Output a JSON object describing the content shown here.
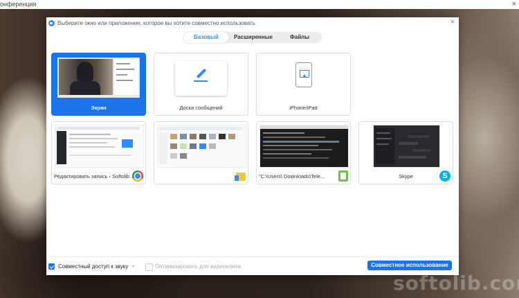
{
  "window": {
    "title": "онференция",
    "close": "×"
  },
  "dialog": {
    "title": "Выберите окно или приложение, которое вы хотите совместно использовать",
    "close": "×"
  },
  "tabs": [
    {
      "label": "Базовый",
      "active": true
    },
    {
      "label": "Расширенные",
      "active": false
    },
    {
      "label": "Файлы",
      "active": false
    }
  ],
  "cards": [
    {
      "label": "Экран",
      "selected": true,
      "icon": "screen-thumbnail"
    },
    {
      "label": "Доска сообщений",
      "selected": false,
      "icon": "pencil-icon"
    },
    {
      "label": "iPhone/iPad",
      "selected": false,
      "icon": "airplay-icon"
    },
    {
      "label": "Редактировать запись ‹ Softolib ...",
      "selected": false,
      "icon": "chrome-icon"
    },
    {
      "label": "",
      "selected": false,
      "icon": "folder-icon"
    },
    {
      "label": "\"C:\\Users\\       Downloads\\Tele...",
      "selected": false,
      "icon": "notepad-icon"
    },
    {
      "label": "Skype",
      "selected": false,
      "icon": "skype-icon"
    }
  ],
  "footer": {
    "share_audio": {
      "label": "Совместный доступ к звуку",
      "checked": true
    },
    "optimize_video": {
      "label": "Оптимизировать для видеоклипа",
      "checked": false,
      "disabled": true
    },
    "share_button": "Совместное использование"
  },
  "watermark": "softolib.com",
  "colors": {
    "accent": "#1a73e8",
    "zoom_blue": "#2d8cff"
  }
}
